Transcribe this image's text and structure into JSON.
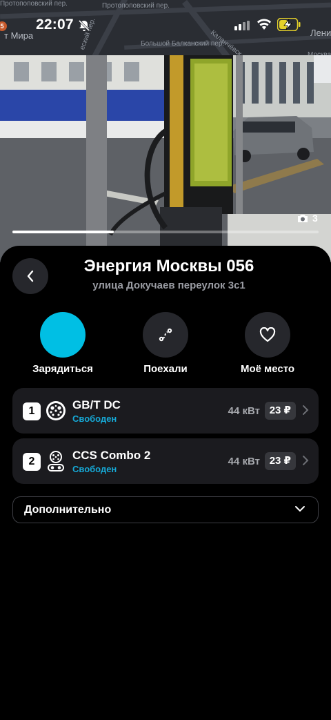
{
  "status_bar": {
    "time": "22:07",
    "icons": [
      "bell-off-icon",
      "signal-icon",
      "wifi-icon",
      "battery-charging-icon"
    ]
  },
  "map": {
    "labels": [
      "Протопоповский пер.",
      "Протопоповский пер.",
      "т Мира",
      "Большой Балканский пер.",
      "Каланчёвск",
      "Лени",
      "Москва-",
      "еский пер."
    ],
    "pin_number": "5"
  },
  "gallery": {
    "photo_count": "3",
    "progress_fraction": 0.33
  },
  "station": {
    "title": "Энергия Москвы 056",
    "address": "улица Докучаев переулок 3с1"
  },
  "actions": [
    {
      "label": "Зарядиться",
      "icon": "bolt-icon"
    },
    {
      "label": "Поехали",
      "icon": "route-icon"
    },
    {
      "label": "Моё место",
      "icon": "heart-icon"
    }
  ],
  "connectors": [
    {
      "number": "1",
      "name": "GB/T DC",
      "status": "Свободен",
      "power": "44 кВт",
      "price": "23 ₽",
      "icon": "gbt-plug-icon"
    },
    {
      "number": "2",
      "name": "CCS Combo 2",
      "status": "Свободен",
      "power": "44 кВт",
      "price": "23 ₽",
      "icon": "ccs-plug-icon"
    }
  ],
  "more": {
    "label": "Дополнительно"
  },
  "colors": {
    "accent": "#00bfe4",
    "status_free": "#16a9d6",
    "sheet_bg": "#000000",
    "card_bg": "#1b1b1f"
  }
}
